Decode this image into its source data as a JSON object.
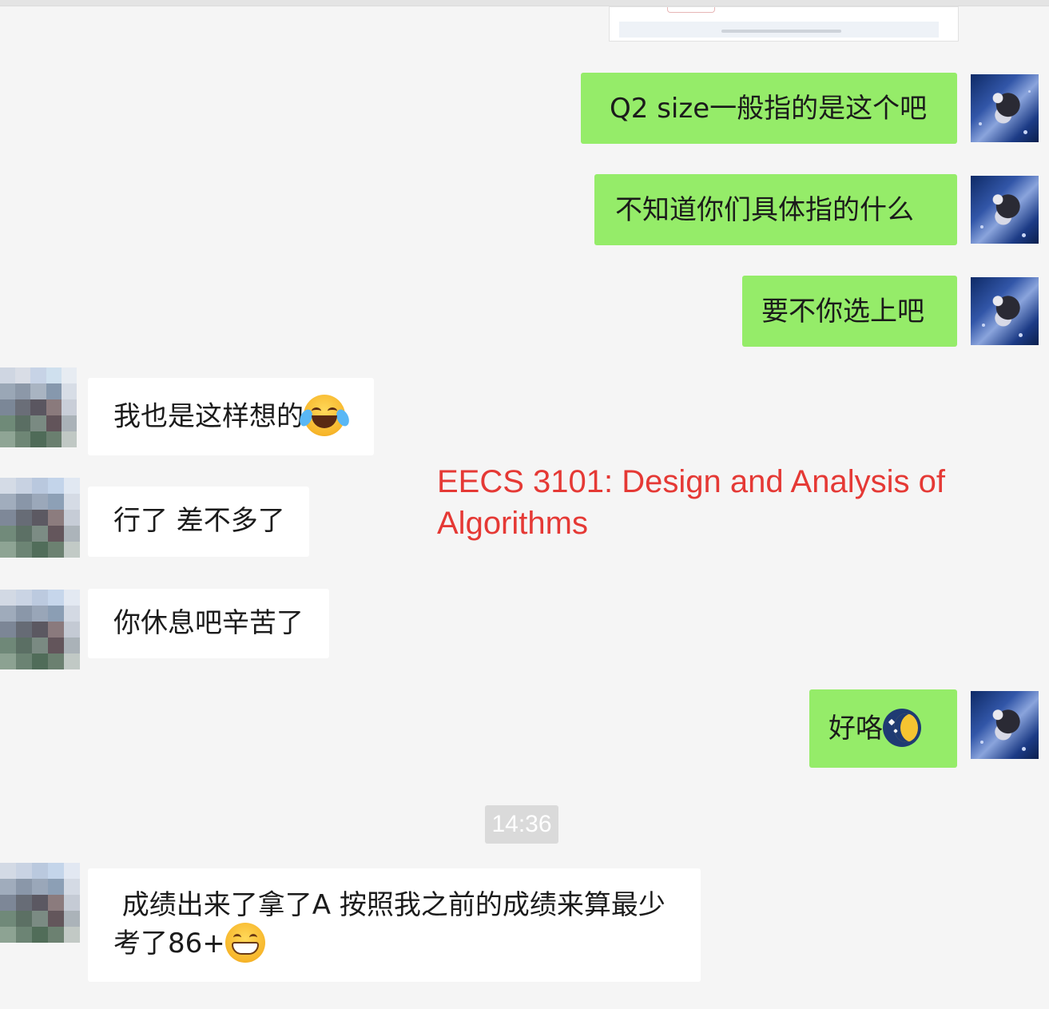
{
  "conversation": {
    "messages": [
      {
        "side": "me",
        "text": "Q2 size一般指的是这个吧"
      },
      {
        "side": "me",
        "text": "不知道你们具体指的什么"
      },
      {
        "side": "me",
        "text": "要不你选上吧"
      },
      {
        "side": "other",
        "text": "我也是这样想的",
        "emoji": "tears-of-joy-emoji"
      },
      {
        "side": "other",
        "text": "行了 差不多了"
      },
      {
        "side": "other",
        "text": "你休息吧辛苦了"
      },
      {
        "side": "me",
        "text": "好咯",
        "emoji": "crescent-moon-emoji"
      },
      {
        "side": "other",
        "text_line1": " 成绩出来了拿了A 按照我之前的成绩来算最少",
        "text_line2": "考了86+",
        "emoji": "grinning-face-emoji"
      }
    ],
    "timestamp": "14:36"
  },
  "watermark": {
    "line1": "EECS 3101: Design and Analysis of",
    "line2": "Algorithms",
    "color": "#e53935"
  },
  "colors": {
    "my_bubble": "#95ec69",
    "other_bubble": "#ffffff",
    "background": "#f5f5f5",
    "timestamp_bg": "#dadada"
  }
}
